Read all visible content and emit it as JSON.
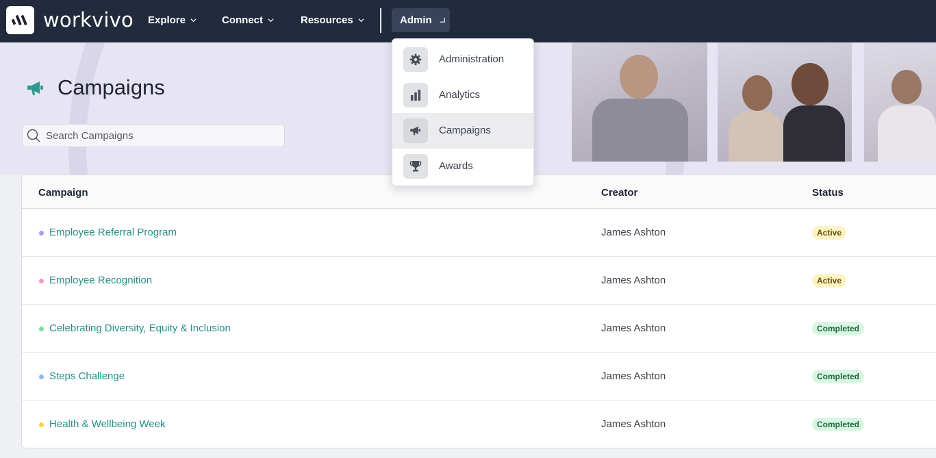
{
  "brand": {
    "name": "workvivo"
  },
  "nav": {
    "items": [
      {
        "label": "Explore"
      },
      {
        "label": "Connect"
      },
      {
        "label": "Resources"
      }
    ],
    "admin_label": "Admin"
  },
  "admin_menu": {
    "items": [
      {
        "label": "Administration",
        "icon": "gear-icon"
      },
      {
        "label": "Analytics",
        "icon": "bar-chart-icon"
      },
      {
        "label": "Campaigns",
        "icon": "megaphone-icon",
        "selected": true
      },
      {
        "label": "Awards",
        "icon": "trophy-icon"
      }
    ]
  },
  "page": {
    "title": "Campaigns",
    "search_placeholder": "Search Campaigns"
  },
  "table": {
    "headers": {
      "campaign": "Campaign",
      "creator": "Creator",
      "status": "Status"
    },
    "rows": [
      {
        "campaign": "Employee Referral Program",
        "creator": "James Ashton",
        "status": "Active",
        "dot_color": "#9ea3f0"
      },
      {
        "campaign": "Employee Recognition",
        "creator": "James Ashton",
        "status": "Active",
        "dot_color": "#f29ac8"
      },
      {
        "campaign": "Celebrating Diversity, Equity & Inclusion",
        "creator": "James Ashton",
        "status": "Completed",
        "dot_color": "#7fdc9c"
      },
      {
        "campaign": "Steps Challenge",
        "creator": "James Ashton",
        "status": "Completed",
        "dot_color": "#8fb9f2"
      },
      {
        "campaign": "Health & Wellbeing Week",
        "creator": "James Ashton",
        "status": "Completed",
        "dot_color": "#f5d34b"
      }
    ]
  },
  "colors": {
    "topbar": "#222b3d",
    "link": "#258f83",
    "accent_icon": "#2f9a8c"
  }
}
